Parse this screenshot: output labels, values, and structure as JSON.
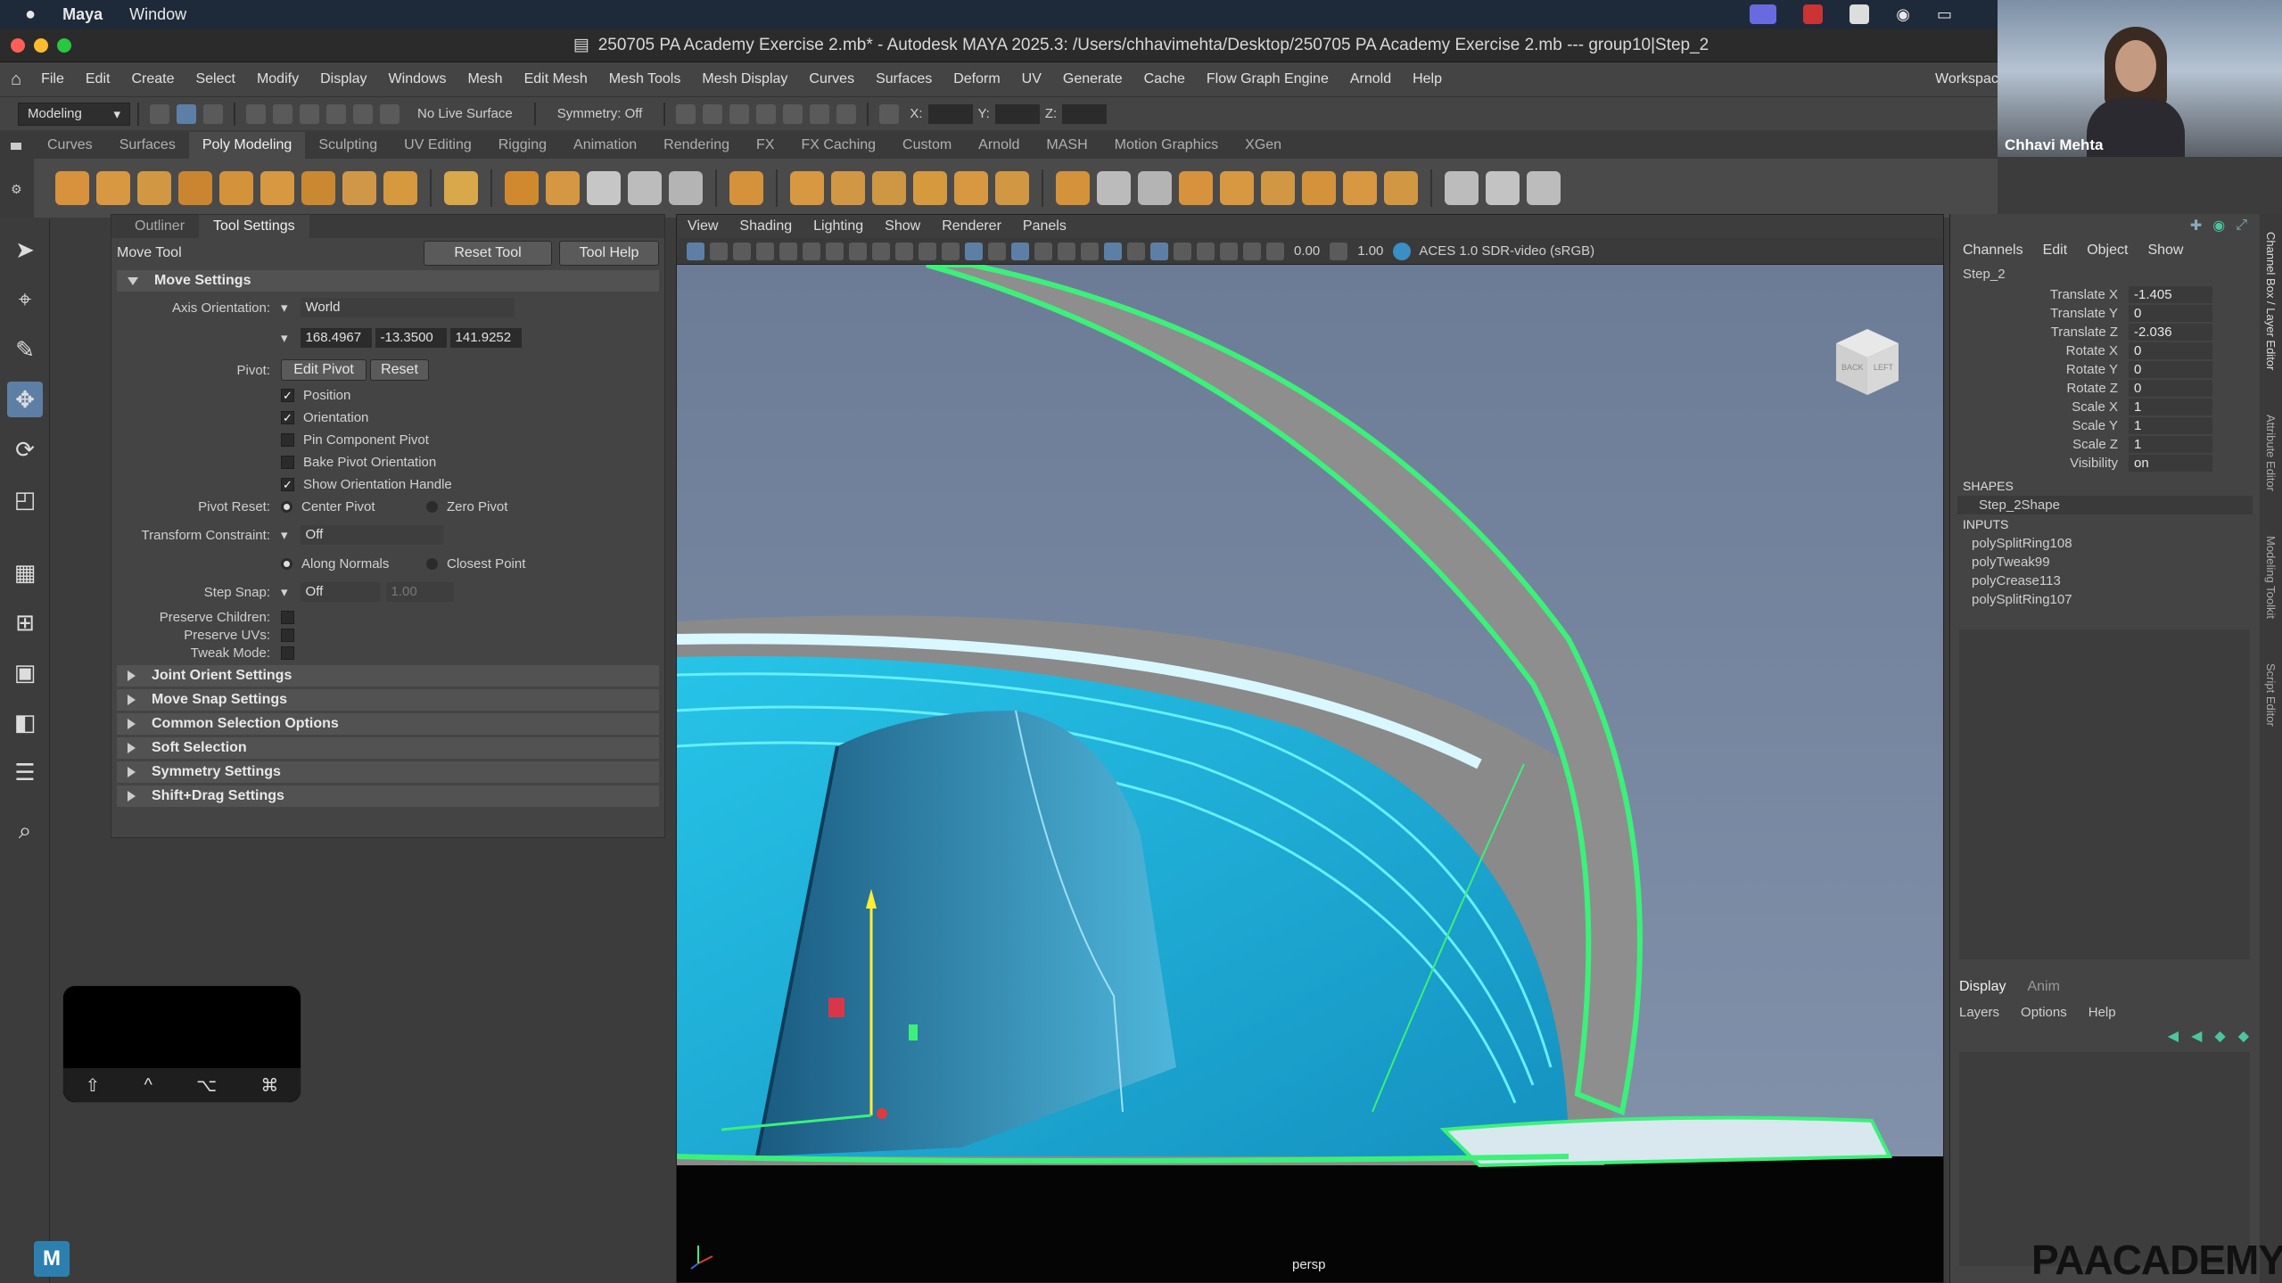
{
  "mac_menu": {
    "app": "Maya",
    "items": [
      "Window"
    ]
  },
  "window_title": "250705 PA Academy Exercise 2.mb* - Autodesk MAYA 2025.3: /Users/chhavimehta/Desktop/250705 PA Academy Exercise 2.mb  ---  group10|Step_2",
  "menubar": [
    "File",
    "Edit",
    "Create",
    "Select",
    "Modify",
    "Display",
    "Windows",
    "Mesh",
    "Edit Mesh",
    "Mesh Tools",
    "Mesh Display",
    "Curves",
    "Surfaces",
    "Deform",
    "UV",
    "Generate",
    "Cache",
    "Flow Graph Engine",
    "Arnold",
    "Help"
  ],
  "workspace_label": "Workspac",
  "statusline": {
    "mode": "Modeling",
    "live_surface": "No Live Surface",
    "symmetry": "Symmetry: Off",
    "x_label": "X:",
    "y_label": "Y:",
    "z_label": "Z:"
  },
  "shelf_tabs": [
    "Curves",
    "Surfaces",
    "Poly Modeling",
    "Sculpting",
    "UV Editing",
    "Rigging",
    "Animation",
    "Rendering",
    "FX",
    "FX Caching",
    "Custom",
    "Arnold",
    "MASH",
    "Motion Graphics",
    "XGen"
  ],
  "shelf_active": "Poly Modeling",
  "shelf_icon_colors": [
    "#e89a3c",
    "#e8a040",
    "#e0a042",
    "#d98c2e",
    "#e39a3a",
    "#e8a040",
    "#d8902f",
    "#e0a048",
    "#e6a23c",
    "#e8b24a",
    "#e0902c",
    "#e4a040",
    "#d4d4d4",
    "#c9c9c9",
    "#c0c0c0",
    "#e49a3a",
    "#e8a040",
    "#e0a044",
    "#dca042",
    "#e6a23c",
    "#e8a040",
    "#e0a042",
    "#e39a3a",
    "#c8c8c8",
    "#c0c0c0",
    "#e89a3c",
    "#e8a040",
    "#e0a042",
    "#e39a3a",
    "#e8a040",
    "#e0a042",
    "#c9c9c9",
    "#d0d0d0",
    "#c9c9c9"
  ],
  "panel": {
    "tabs": [
      "Outliner",
      "Tool Settings"
    ],
    "active_tab": "Tool Settings",
    "tool_name": "Move Tool",
    "reset_tool": "Reset Tool",
    "tool_help": "Tool Help",
    "move_settings": "Move Settings",
    "axis_orientation_label": "Axis Orientation:",
    "axis_orientation_value": "World",
    "coords": [
      "168.4967",
      "-13.3500",
      "141.9252"
    ],
    "pivot_label": "Pivot:",
    "edit_pivot": "Edit Pivot",
    "reset": "Reset",
    "checks": [
      {
        "label": "Position",
        "checked": true
      },
      {
        "label": "Orientation",
        "checked": true
      },
      {
        "label": "Pin Component Pivot",
        "checked": false
      },
      {
        "label": "Bake Pivot Orientation",
        "checked": false
      },
      {
        "label": "Show Orientation Handle",
        "checked": true
      }
    ],
    "pivot_reset_label": "Pivot Reset:",
    "center_pivot": "Center Pivot",
    "zero_pivot": "Zero Pivot",
    "transform_constraint_label": "Transform Constraint:",
    "transform_constraint_value": "Off",
    "along_normals": "Along Normals",
    "closest_point": "Closest Point",
    "step_snap_label": "Step Snap:",
    "step_snap_value": "Off",
    "step_snap_num": "1.00",
    "preserve_children": "Preserve Children:",
    "preserve_uvs": "Preserve UVs:",
    "tweak_mode": "Tweak Mode:",
    "sections": [
      "Joint Orient Settings",
      "Move Snap Settings",
      "Common Selection Options",
      "Soft Selection",
      "Symmetry Settings",
      "Shift+Drag Settings"
    ]
  },
  "viewport": {
    "menu": [
      "View",
      "Shading",
      "Lighting",
      "Show",
      "Renderer",
      "Panels"
    ],
    "val1": "0.00",
    "val2": "1.00",
    "colorspace": "ACES 1.0 SDR-video (sRGB)",
    "camera": "persp",
    "cube_back": "BACK",
    "cube_left": "LEFT"
  },
  "channel_box": {
    "menu": [
      "Channels",
      "Edit",
      "Object",
      "Show"
    ],
    "object": "Step_2",
    "attrs": [
      {
        "name": "Translate X",
        "value": "-1.405"
      },
      {
        "name": "Translate Y",
        "value": "0"
      },
      {
        "name": "Translate Z",
        "value": "-2.036"
      },
      {
        "name": "Rotate X",
        "value": "0"
      },
      {
        "name": "Rotate Y",
        "value": "0"
      },
      {
        "name": "Rotate Z",
        "value": "0"
      },
      {
        "name": "Scale X",
        "value": "1"
      },
      {
        "name": "Scale Y",
        "value": "1"
      },
      {
        "name": "Scale Z",
        "value": "1"
      },
      {
        "name": "Visibility",
        "value": "on"
      }
    ],
    "shapes_label": "SHAPES",
    "shape": "Step_2Shape",
    "inputs_label": "INPUTS",
    "inputs": [
      "polySplitRing108",
      "polyTweak99",
      "polyCrease113",
      "polySplitRing107"
    ],
    "layer_tabs": [
      "Display",
      "Anim"
    ],
    "layer_menu": [
      "Layers",
      "Options",
      "Help"
    ]
  },
  "side_tabs": [
    "Channel Box / Layer Editor",
    "Attribute Editor",
    "Modeling Toolkit",
    "Script Editor"
  ],
  "webcam_name": "Chhavi Mehta",
  "key_overlay": [
    "⇧",
    "^",
    "⌥",
    "⌘"
  ],
  "logo": "PAACADEMY",
  "accent": "#5d7fa6"
}
